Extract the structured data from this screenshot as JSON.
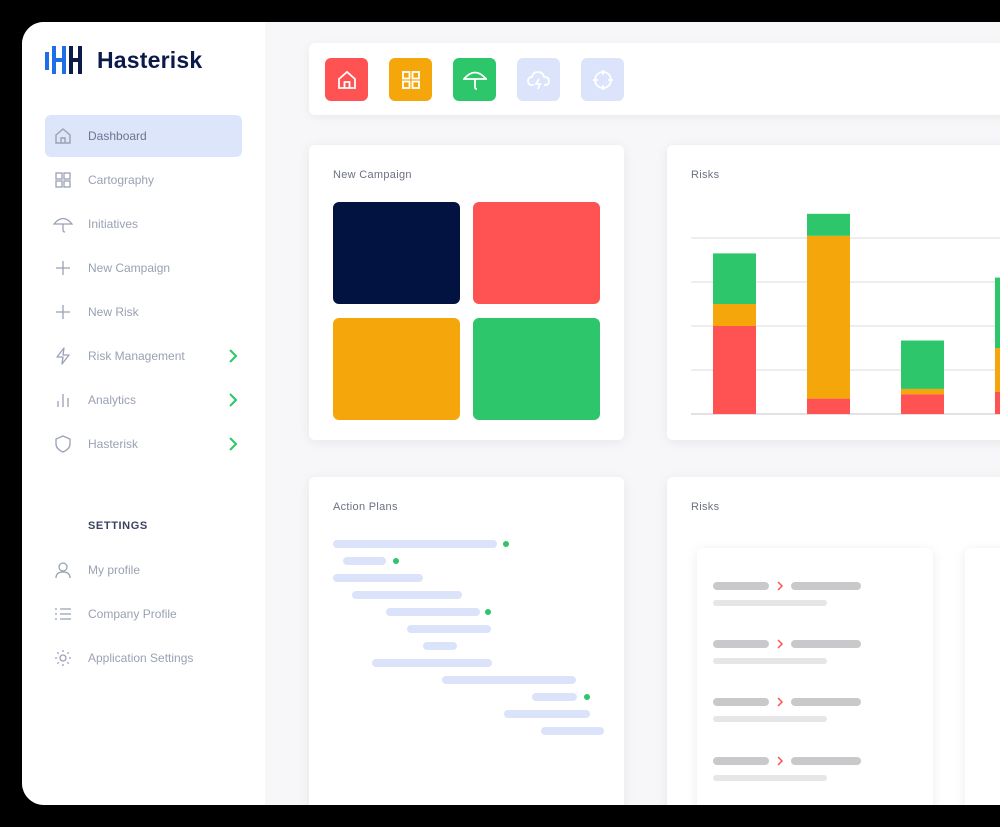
{
  "app": {
    "name": "Hasterisk"
  },
  "sidebar": {
    "items": [
      {
        "label": "Dashboard",
        "icon": "home-icon",
        "active": true
      },
      {
        "label": "Cartography",
        "icon": "grid-icon"
      },
      {
        "label": "Initiatives",
        "icon": "umbrella-icon"
      },
      {
        "label": "New Campaign",
        "icon": "plus-icon"
      },
      {
        "label": "New Risk",
        "icon": "plus-icon"
      },
      {
        "label": "Risk Management",
        "icon": "lightning-icon",
        "expandable": true
      },
      {
        "label": "Analytics",
        "icon": "bar-chart-icon",
        "expandable": true
      },
      {
        "label": "Hasterisk",
        "icon": "shield-icon",
        "expandable": true
      }
    ],
    "settings_title": "SETTINGS",
    "settings_items": [
      {
        "label": "My profile",
        "icon": "user-icon"
      },
      {
        "label": "Company Profile",
        "icon": "list-icon"
      },
      {
        "label": "Application Settings",
        "icon": "gear-icon"
      }
    ]
  },
  "toolbar": {
    "buttons": [
      {
        "icon": "home-icon",
        "color": "#ff5252"
      },
      {
        "icon": "grid-icon",
        "color": "#f5a60b"
      },
      {
        "icon": "umbrella-icon",
        "color": "#2dc66b"
      },
      {
        "icon": "cloud-lightning-icon",
        "color": "#dbe4fb"
      },
      {
        "icon": "target-icon",
        "color": "#dbe4fb"
      }
    ]
  },
  "cards": {
    "new_campaign": {
      "title": "New Campaign",
      "tile_colors": [
        "#021341",
        "#ff5252",
        "#f5a60b",
        "#2dc66b"
      ]
    },
    "risks_chart": {
      "title": "Risks"
    },
    "action_plans": {
      "title": "Action Plans"
    },
    "risks_list": {
      "title": "Risks"
    }
  },
  "colors": {
    "red": "#ff5252",
    "orange": "#f5a60b",
    "green": "#2dc66b",
    "navy": "#021341",
    "accent_light": "#dde5fb"
  },
  "chart_data": {
    "type": "bar",
    "categories": [
      "",
      "",
      "",
      ""
    ],
    "series": [
      {
        "color": "#ff5252",
        "values": [
          2.0,
          0.35,
          0.45,
          0.5
        ]
      },
      {
        "color": "#f5a60b",
        "values": [
          0.5,
          3.7,
          0.12,
          1.0
        ]
      },
      {
        "color": "#2dc66b",
        "values": [
          1.15,
          0.5,
          1.1,
          1.6
        ]
      }
    ],
    "stacked": true,
    "ylim": [
      0,
      4
    ],
    "grid": true,
    "title": "Risks"
  }
}
